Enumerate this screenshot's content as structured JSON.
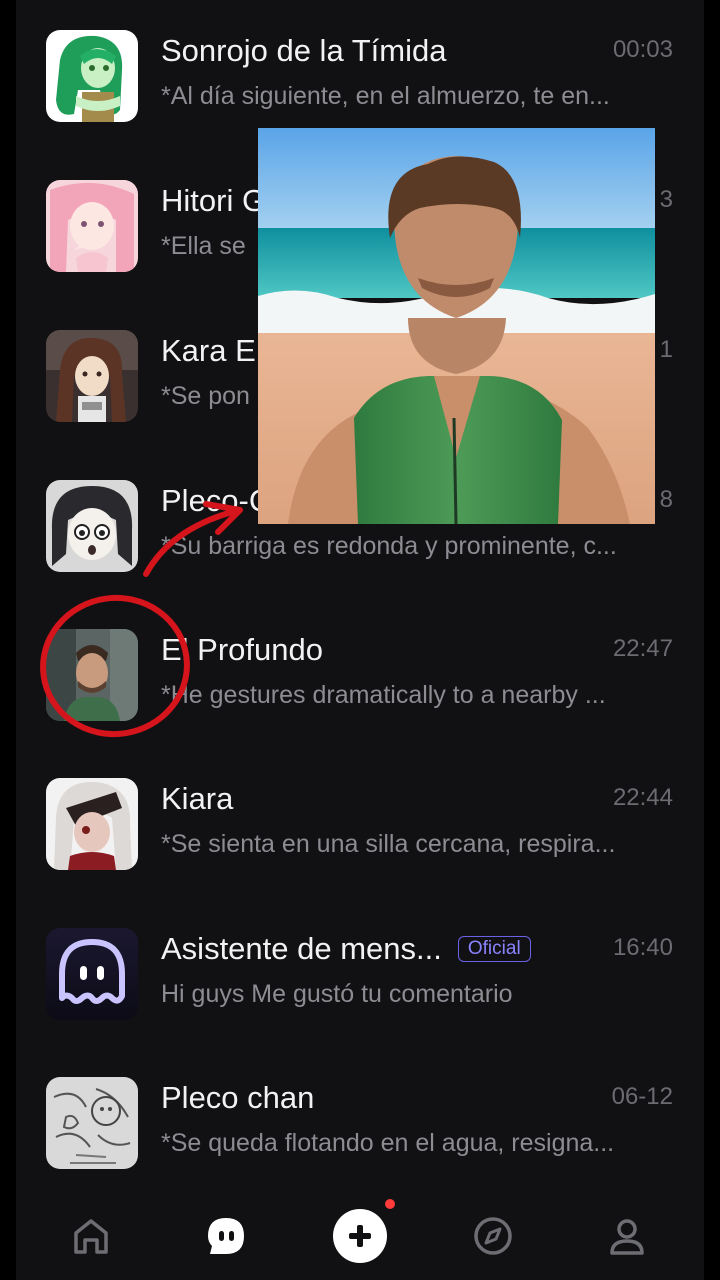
{
  "chats": [
    {
      "name": "Sonrojo de la Tímida",
      "time": "00:03",
      "preview": "*Al día siguiente, en el almuerzo, te en...",
      "avatar_icon": "green-haired-girl-avatar",
      "official": false
    },
    {
      "name": "Hitori G",
      "time": "3",
      "preview": "*Ella se",
      "avatar_icon": "pink-haired-girl-avatar",
      "official": false
    },
    {
      "name": "Kara E",
      "time": "1",
      "preview": "*Se pon",
      "avatar_icon": "brown-haired-girl-avatar",
      "official": false
    },
    {
      "name": "Pleco-C",
      "time": "8",
      "preview": "*Su barriga es redonda y prominente, c...",
      "avatar_icon": "dark-haired-chibi-avatar",
      "official": false
    },
    {
      "name": "El Profundo",
      "time": "22:47",
      "preview": "*He gestures dramatically to a nearby ...",
      "avatar_icon": "man-photo-avatar",
      "official": false
    },
    {
      "name": "Kiara",
      "time": "22:44",
      "preview": "*Se sienta en una silla cercana, respira...",
      "avatar_icon": "white-haired-girl-avatar",
      "official": false
    },
    {
      "name": "Asistente de mens...",
      "badge": "Oficial",
      "time": "16:40",
      "preview": "Hi guys Me gustó tu comentario",
      "avatar_icon": "assistant-ghost-logo",
      "official": true
    },
    {
      "name": "Pleco chan",
      "time": "06-12",
      "preview": "*Se queda flotando en el agua, resigna...",
      "avatar_icon": "sketch-drawing-avatar",
      "official": false
    }
  ],
  "nav": [
    {
      "icon": "home-icon"
    },
    {
      "icon": "chat-bubble-icon",
      "active": true
    },
    {
      "icon": "create-plus-icon",
      "has_dot": true
    },
    {
      "icon": "explore-compass-icon"
    },
    {
      "icon": "profile-icon"
    }
  ],
  "overlay": {
    "description_icon": "video-overlay-man-on-beach"
  },
  "colors": {
    "background": "#111113",
    "name_text": "#f2f2f4",
    "preview_text": "#8c8c93",
    "time_text": "#6b6b72",
    "badge": "#8a83ff",
    "annotation_red": "#d5141c",
    "notification_dot": "#ff3b3b"
  }
}
